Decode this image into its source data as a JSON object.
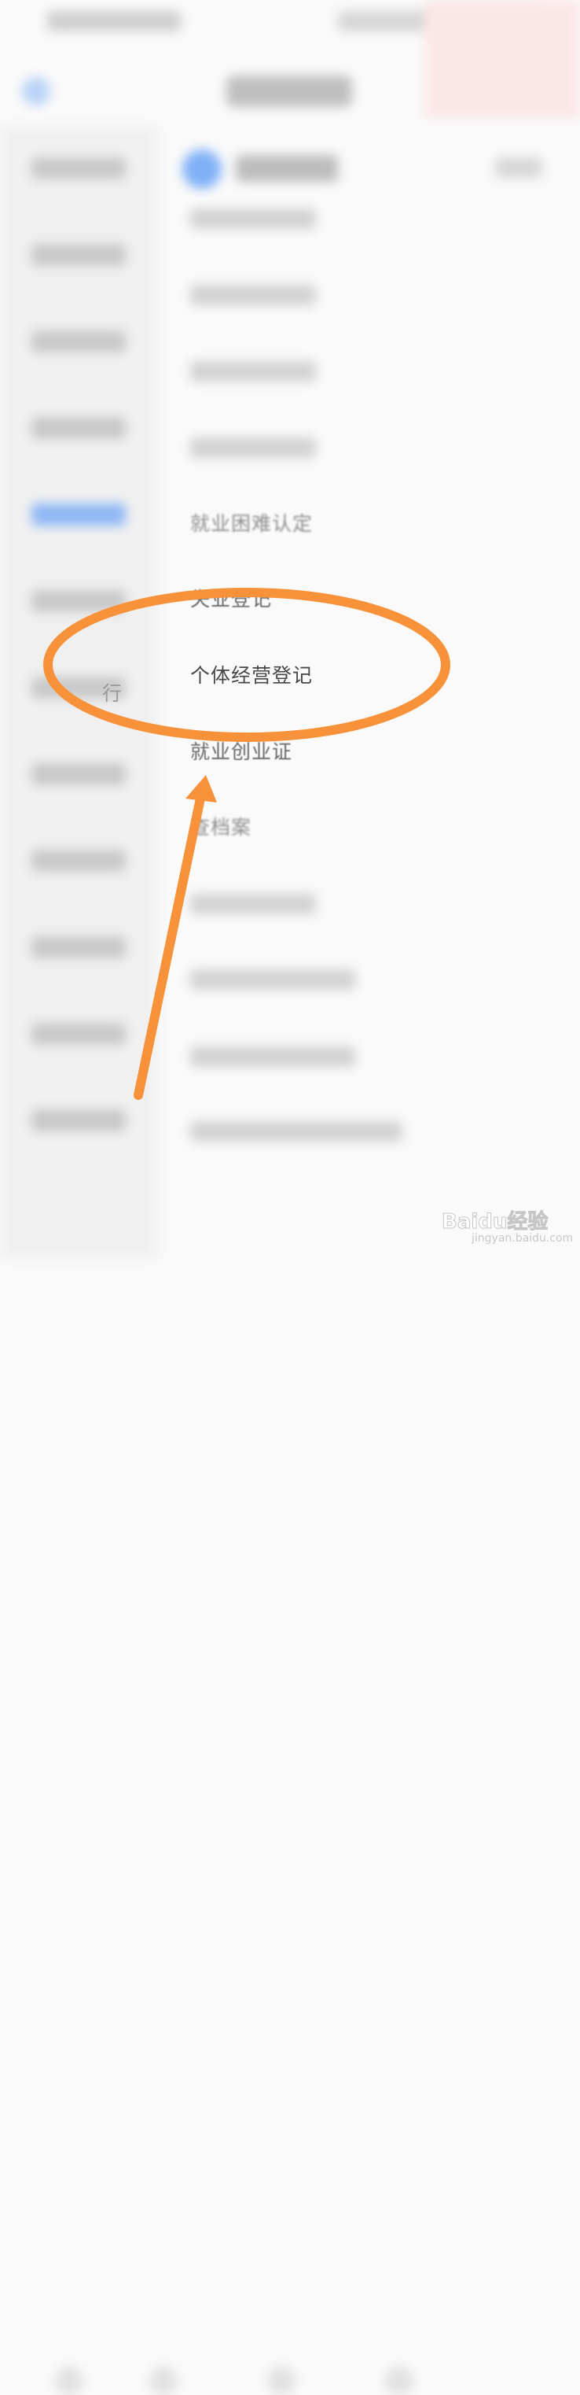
{
  "menu": {
    "items": [
      {
        "label": "就业困难认定",
        "state": "faint"
      },
      {
        "label": "失业登记",
        "state": "mid"
      },
      {
        "label": "个体经营登记",
        "state": "highlighted"
      },
      {
        "label": "就业创业证",
        "state": "mid"
      },
      {
        "label": "查档案",
        "state": "faint"
      }
    ]
  },
  "sidebar": {
    "partial_label": "行"
  },
  "annotation": {
    "color": "#f7923a",
    "shapes": [
      "ellipse",
      "arrow"
    ]
  },
  "watermark": {
    "text": "Baidu经验",
    "url": "jingyan.baidu.com"
  },
  "colors": {
    "accent_blue": "#7fb0f7",
    "annotation_orange": "#f7923a"
  }
}
